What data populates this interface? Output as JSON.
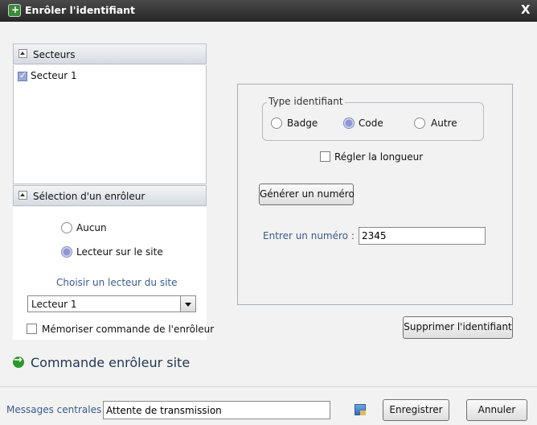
{
  "window": {
    "title": "Enrôler l'identifiant",
    "close_label": "X"
  },
  "sectors": {
    "header": "Secteurs",
    "items": [
      {
        "label": "Secteur 1",
        "checked": true
      }
    ]
  },
  "enroller": {
    "header": "Sélection d'un enrôleur",
    "options": [
      {
        "label": "Aucun",
        "selected": false
      },
      {
        "label": "Lecteur sur le site",
        "selected": true
      }
    ],
    "reader_prompt": "Choisir un lecteur du site",
    "reader_value": "Lecteur 1",
    "memorize_label": "Mémoriser commande de l'enrôleur",
    "memorize_checked": false
  },
  "command": {
    "label": "Commande enrôleur site"
  },
  "identifier": {
    "type_legend": "Type identifiant",
    "types": [
      {
        "label": "Badge",
        "selected": false
      },
      {
        "label": "Code",
        "selected": true
      },
      {
        "label": "Autre",
        "selected": false
      }
    ],
    "length_label": "Régler la longueur",
    "length_checked": false,
    "generate_button": "Générer un numéro",
    "enter_label": "Entrer un numéro :",
    "number_value": "2345",
    "delete_button": "Supprimer l'identifiant"
  },
  "footer": {
    "messages_label": "Messages centrales",
    "messages_value": "Attente de transmission",
    "tray_icon": "network-computer-icon",
    "save_button": "Enregistrer",
    "cancel_button": "Annuler"
  },
  "colors": {
    "titlebar": "#262626",
    "accent_radio": "#8f97d2",
    "command_arrow": "#2a9a2a"
  }
}
